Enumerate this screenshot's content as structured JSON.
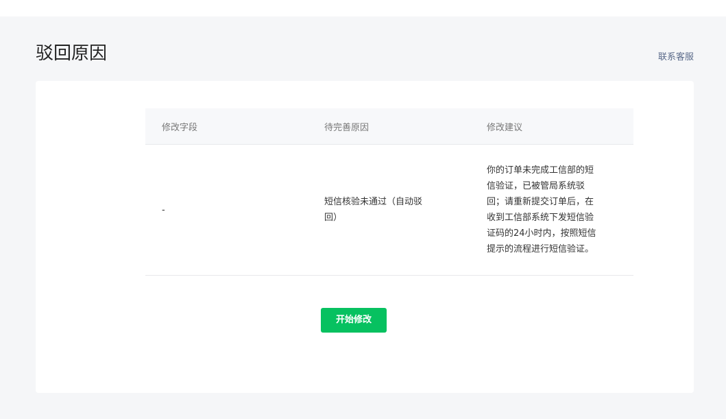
{
  "page": {
    "title": "驳回原因",
    "contact_label": "联系客服"
  },
  "table": {
    "headers": [
      "修改字段",
      "待完善原因",
      "修改建议"
    ],
    "rows": [
      {
        "field": "-",
        "reason": "短信核验未通过（自动驳回）",
        "advice": "你的订单未完成工信部的短信验证，已被管局系统驳回；请重新提交订单后，在收到工信部系统下发短信验证码的24小时内，按照短信提示的流程进行短信验证。"
      }
    ]
  },
  "actions": {
    "start_label": "开始修改"
  },
  "colors": {
    "primary": "#07c160",
    "background": "#f5f6f8",
    "link": "#5a6a8a"
  }
}
